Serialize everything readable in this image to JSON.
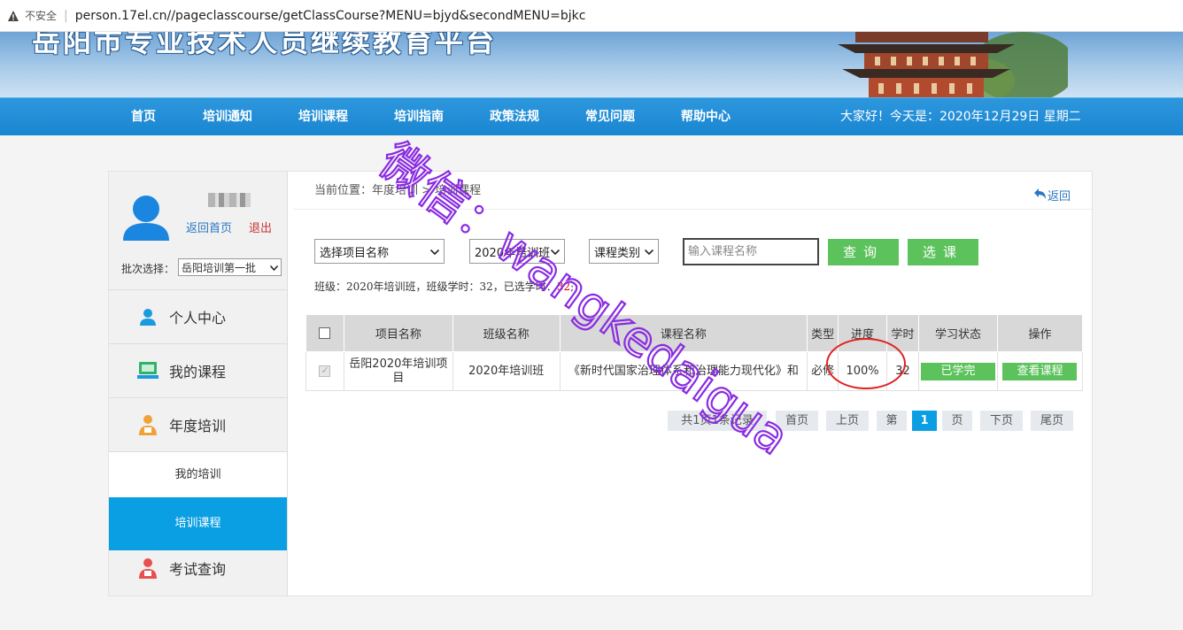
{
  "browser": {
    "insecure_label": "不安全",
    "url": "person.17el.cn//pageclasscourse/getClassCourse?MENU=bjyd&secondMENU=bjkc"
  },
  "banner": {
    "title": "岳阳市专业技术人员继续教育平台"
  },
  "nav": {
    "items": [
      "首页",
      "培训通知",
      "培训课程",
      "培训指南",
      "政策法规",
      "常见问题",
      "帮助中心"
    ],
    "greeting": "大家好！今天是：2020年12月29日 星期二"
  },
  "sidebar": {
    "home_link": "返回首页",
    "logout_link": "退出",
    "batch_label": "批次选择：",
    "batch_value": "岳阳培训第一批",
    "menu": [
      "个人中心",
      "我的课程",
      "年度培训",
      "考试查询"
    ],
    "sub_menu": [
      "我的培训",
      "培训课程"
    ]
  },
  "content": {
    "breadcrumb": "当前位置：年度培训 > 培训课程",
    "back_label": "返回",
    "filters": {
      "project": "选择项目名称",
      "class": "2020年培训班",
      "category": "课程类别",
      "course_placeholder": "输入课程名称",
      "query_button": "查询",
      "select_button": "选课"
    },
    "class_info_prefix": "班级：2020年培训班，班级学时：32，已选学时：",
    "class_info_selected": "32",
    "class_info_suffix": ";",
    "table": {
      "headers": [
        "项目名称",
        "班级名称",
        "课程名称",
        "类型",
        "进度",
        "学时",
        "学习状态",
        "操作"
      ],
      "rows": [
        {
          "project": "岳阳2020年培训项目",
          "class": "2020年培训班",
          "course": "《新时代国家治理体系和治理能力现代化》和",
          "type": "必修",
          "progress": "100%",
          "hours": "32",
          "status": "已学完",
          "action": "查看课程"
        }
      ]
    },
    "pagination": {
      "summary": "共1页1条记录",
      "first": "首页",
      "prev": "上页",
      "page_prefix": "第",
      "current": "1",
      "page_suffix": "页",
      "next": "下页",
      "last": "尾页"
    }
  },
  "watermark": {
    "text": "微信：wangkedaigua"
  },
  "colors": {
    "nav_blue": "#1a86d1",
    "active_blue": "#0a9fe3",
    "button_green": "#5cc25c",
    "watermark_purple": "#8a2be2",
    "annotation_red": "#e02020"
  }
}
